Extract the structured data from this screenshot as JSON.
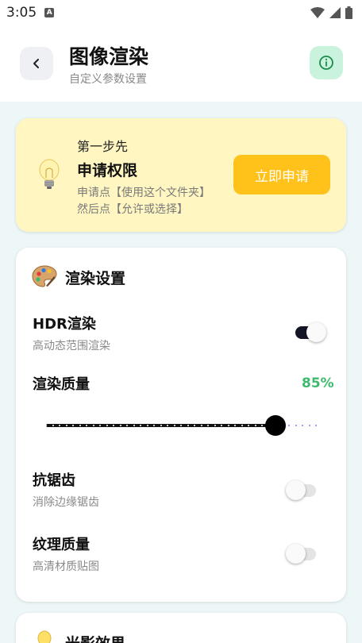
{
  "status_bar": {
    "time": "3:05",
    "badge": "A"
  },
  "header": {
    "title": "图像渲染",
    "subtitle": "自定义参数设置"
  },
  "permission": {
    "step": "第一步先",
    "title": "申请权限",
    "desc_line1": "申请点【使用这个文件夹】",
    "desc_line2": "然后点【允许或选择】",
    "button": "立即申请"
  },
  "render_settings": {
    "title": "渲染设置",
    "hdr": {
      "label": "HDR渲染",
      "desc": "高动态范围渲染",
      "enabled": true
    },
    "quality": {
      "label": "渲染质量",
      "value_text": "85%",
      "value": 0.85
    },
    "antialias": {
      "label": "抗锯齿",
      "desc": "消除边缘锯齿",
      "enabled": false
    },
    "texture": {
      "label": "纹理质量",
      "desc": "高清材质贴图",
      "enabled": false
    }
  },
  "lighting": {
    "title": "光影效果"
  },
  "colors": {
    "accent_green": "#3dbb6c",
    "button_yellow": "#ffc21a",
    "card_yellow": "#fff6c2"
  }
}
